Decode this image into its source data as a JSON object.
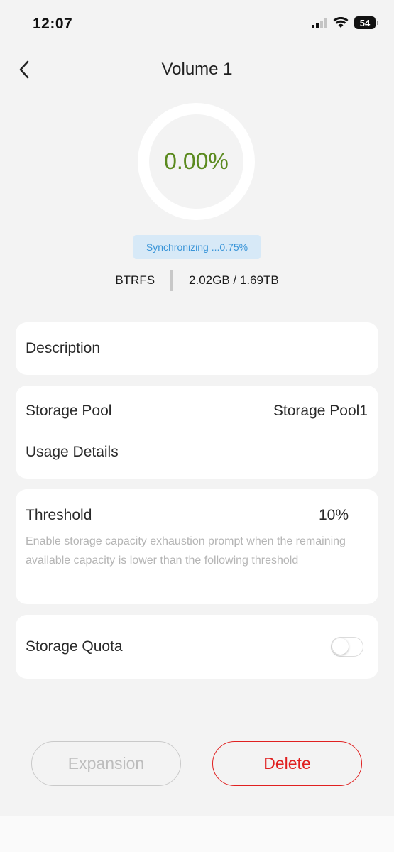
{
  "status_bar": {
    "time": "12:07",
    "battery": "54",
    "icons": [
      "signal-icon",
      "wifi-icon",
      "battery-icon"
    ]
  },
  "header": {
    "title": "Volume 1",
    "back_icon": "chevron-left-icon"
  },
  "usage": {
    "percent_label": "0.00%",
    "percent_value": 0.0,
    "ring_color": "#5b8a1f",
    "sync_status": "Synchronizing ...0.75%",
    "filesystem": "BTRFS",
    "capacity": "2.02GB / 1.69TB"
  },
  "description": {
    "label": "Description"
  },
  "pool": {
    "label": "Storage Pool",
    "value": "Storage Pool1",
    "usage_details_label": "Usage Details"
  },
  "threshold": {
    "label": "Threshold",
    "value": "10%",
    "hint": "Enable storage capacity exhaustion prompt when the remaining available capacity is lower than the following threshold"
  },
  "quota": {
    "label": "Storage Quota",
    "enabled": false
  },
  "actions": {
    "expansion_label": "Expansion",
    "delete_label": "Delete",
    "delete_color": "#e02020"
  }
}
